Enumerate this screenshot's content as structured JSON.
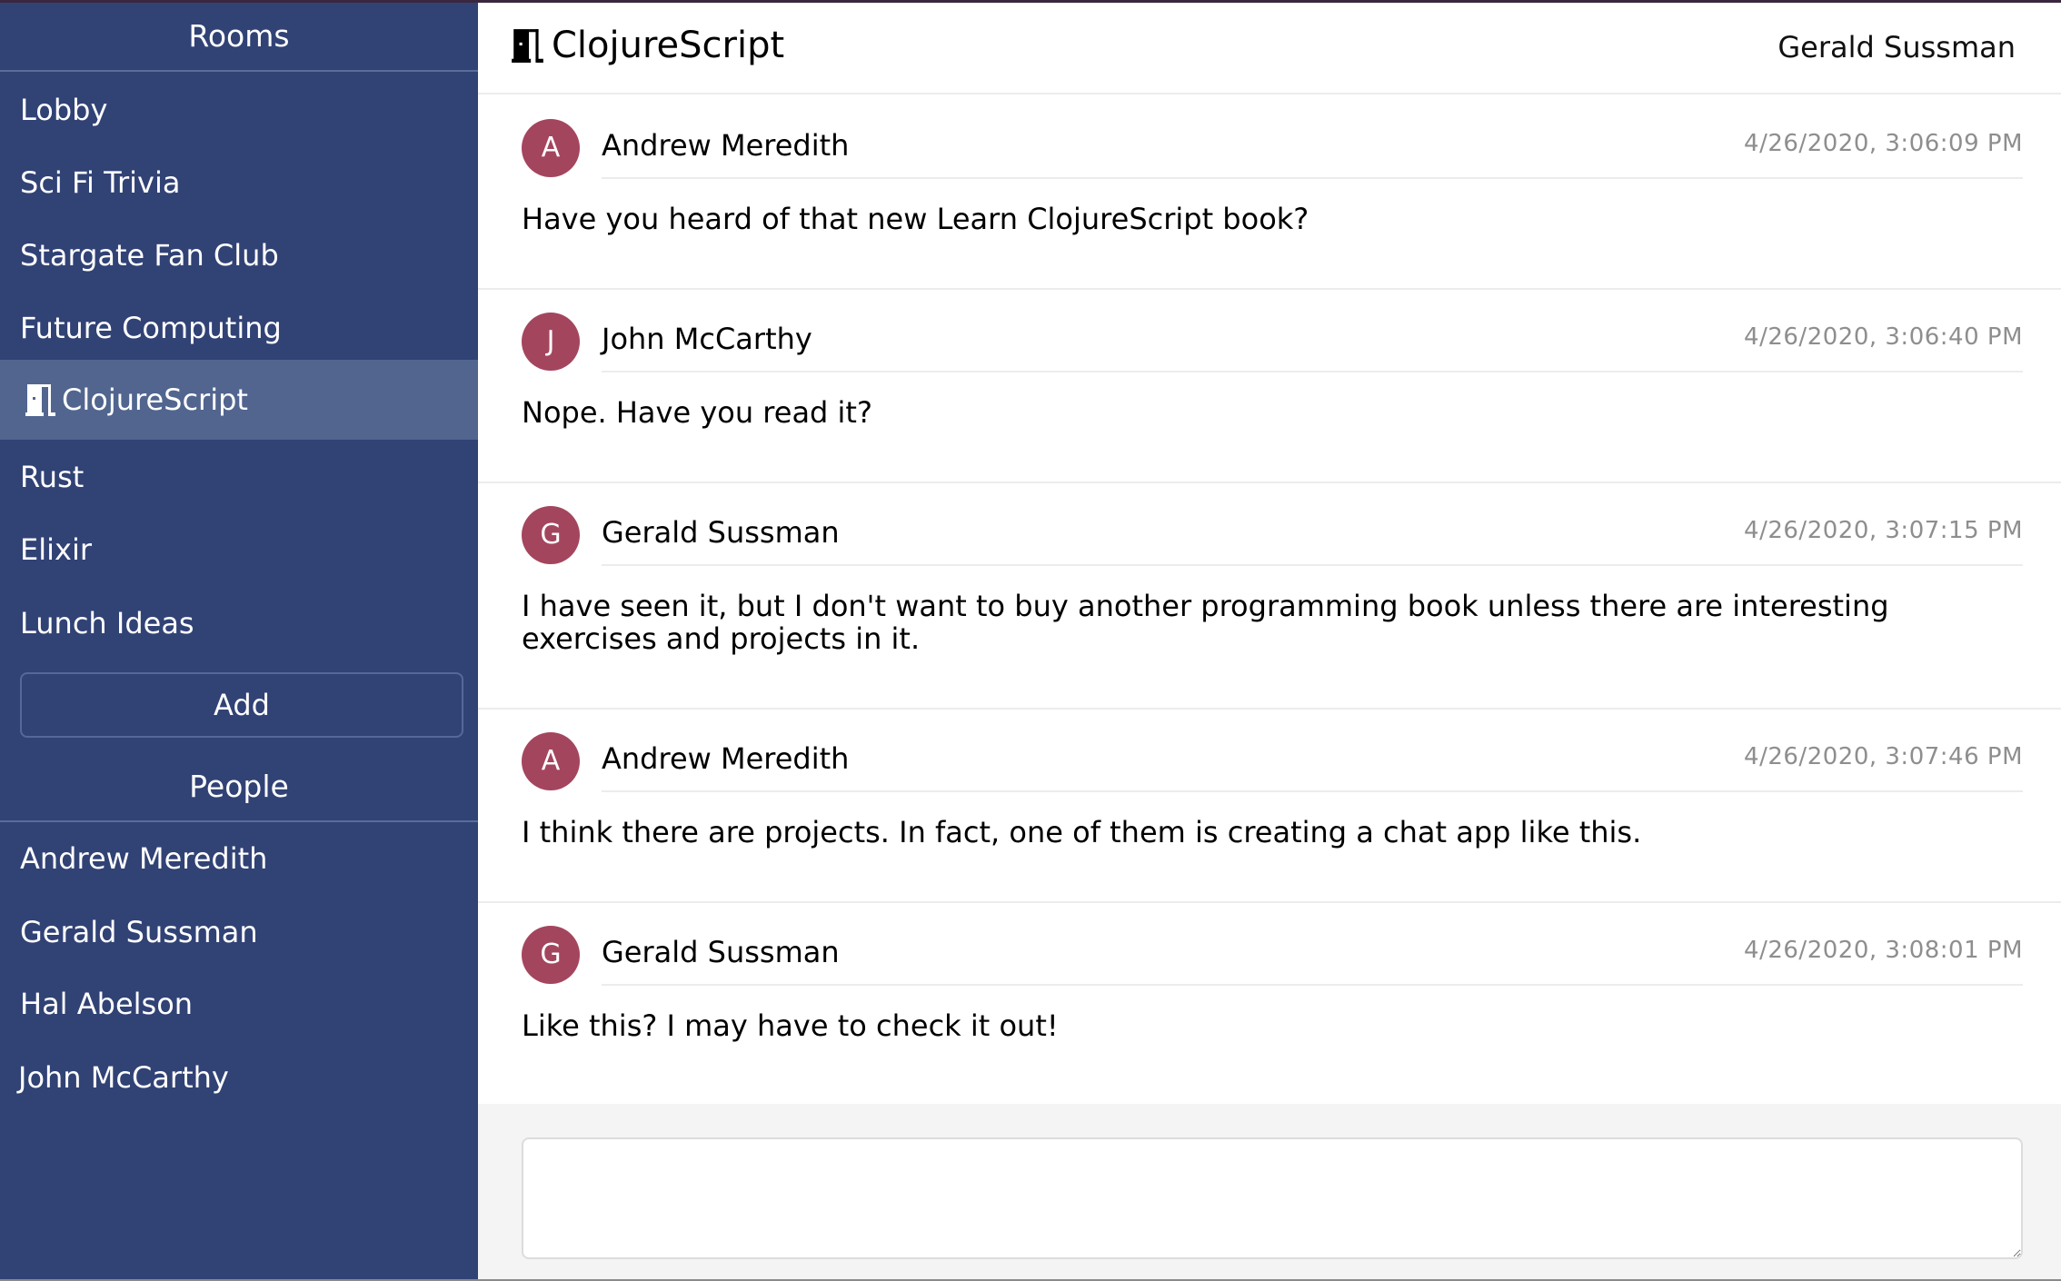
{
  "sidebar": {
    "rooms_heading": "Rooms",
    "rooms": [
      {
        "label": "Lobby",
        "selected": false
      },
      {
        "label": "Sci Fi Trivia",
        "selected": false
      },
      {
        "label": "Stargate Fan Club",
        "selected": false
      },
      {
        "label": "Future Computing",
        "selected": false
      },
      {
        "label": "ClojureScript",
        "selected": true,
        "icon": "door-open-icon"
      },
      {
        "label": "Rust",
        "selected": false
      },
      {
        "label": "Elixir",
        "selected": false
      },
      {
        "label": "Lunch Ideas",
        "selected": false
      }
    ],
    "add_button_label": "Add",
    "people_heading": "People",
    "people": [
      {
        "label": "Andrew Meredith"
      },
      {
        "label": "Gerald Sussman"
      },
      {
        "label": "Hal Abelson"
      },
      {
        "label": "John McCarthy"
      }
    ]
  },
  "header": {
    "room_icon": "door-open-icon",
    "room_title": "ClojureScript",
    "current_user": "Gerald Sussman"
  },
  "messages": [
    {
      "initial": "A",
      "author": "Andrew Meredith",
      "timestamp": "4/26/2020, 3:06:09 PM",
      "text": "Have you heard of that new Learn ClojureScript book?"
    },
    {
      "initial": "J",
      "author": "John McCarthy",
      "timestamp": "4/26/2020, 3:06:40 PM",
      "text": "Nope. Have you read it?"
    },
    {
      "initial": "G",
      "author": "Gerald Sussman",
      "timestamp": "4/26/2020, 3:07:15 PM",
      "text": "I have seen it, but I don't want to buy another programming book unless there are interesting exercises and projects in it."
    },
    {
      "initial": "A",
      "author": "Andrew Meredith",
      "timestamp": "4/26/2020, 3:07:46 PM",
      "text": "I think there are projects. In fact, one of them is creating a chat app like this."
    },
    {
      "initial": "G",
      "author": "Gerald Sussman",
      "timestamp": "4/26/2020, 3:08:01 PM",
      "text": "Like this? I may have to check it out!"
    }
  ],
  "composer": {
    "value": "",
    "placeholder": ""
  },
  "colors": {
    "sidebar_bg": "#314275",
    "sidebar_selected": "#51658f",
    "avatar_bg": "#a4455e",
    "timestamp": "#8e8e8e"
  }
}
